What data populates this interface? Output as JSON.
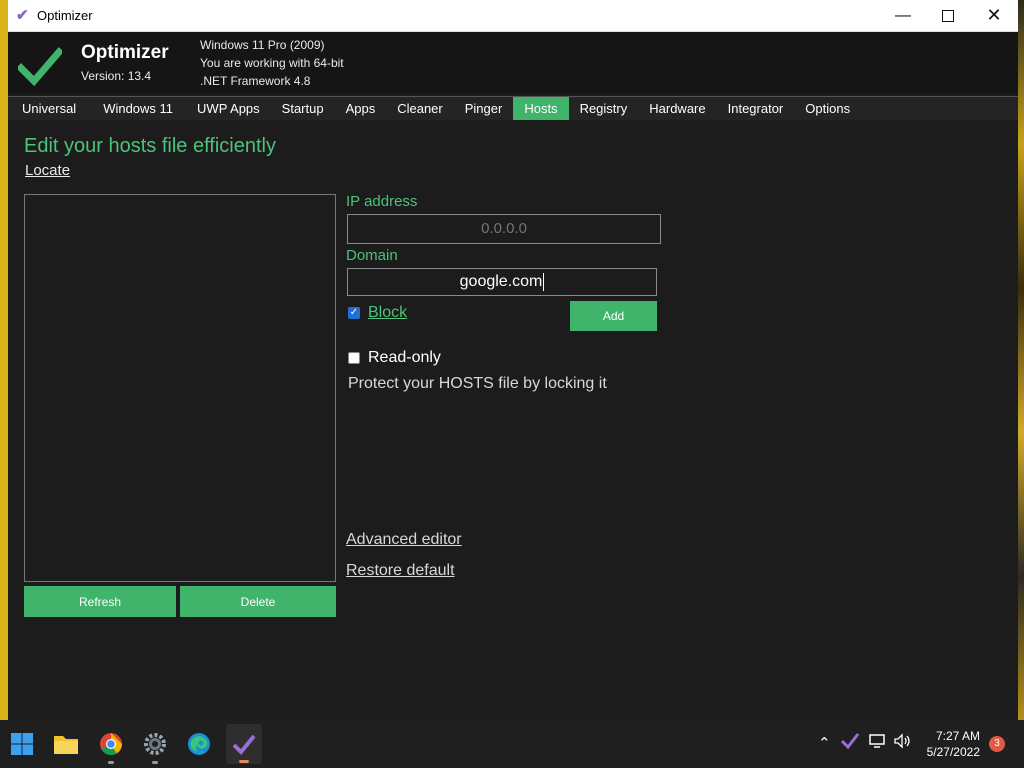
{
  "window": {
    "title": "Optimizer"
  },
  "header": {
    "app_name": "Optimizer",
    "version": "Version: 13.4",
    "os": "Windows 11 Pro (2009)",
    "arch": "You are working with 64-bit",
    "framework": ".NET Framework 4.8"
  },
  "tabs": [
    {
      "label": "Universal",
      "active": false
    },
    {
      "label": "Windows 11",
      "active": false
    },
    {
      "label": "UWP Apps",
      "active": false
    },
    {
      "label": "Startup",
      "active": false
    },
    {
      "label": "Apps",
      "active": false
    },
    {
      "label": "Cleaner",
      "active": false
    },
    {
      "label": "Pinger",
      "active": false
    },
    {
      "label": "Hosts",
      "active": true
    },
    {
      "label": "Registry",
      "active": false
    },
    {
      "label": "Hardware",
      "active": false
    },
    {
      "label": "Integrator",
      "active": false
    },
    {
      "label": "Options",
      "active": false
    }
  ],
  "hosts": {
    "heading": "Edit your hosts file efficiently",
    "locate": "Locate",
    "refresh": "Refresh",
    "delete": "Delete",
    "ip_label": "IP address",
    "ip_placeholder": "0.0.0.0",
    "domain_label": "Domain",
    "domain_value": "google.com",
    "block_label": "Block",
    "block_checked": true,
    "add": "Add",
    "readonly_label": "Read-only",
    "readonly_checked": false,
    "protect_text": "Protect your HOSTS file by locking it",
    "advanced_editor": "Advanced editor",
    "restore_default": "Restore default"
  },
  "taskbar": {
    "time": "7:27 AM",
    "date": "5/27/2022",
    "notifications": "3"
  },
  "colors": {
    "accent": "#3fb46a",
    "accent_text": "#4cc27a",
    "background": "#1c1c1c"
  }
}
